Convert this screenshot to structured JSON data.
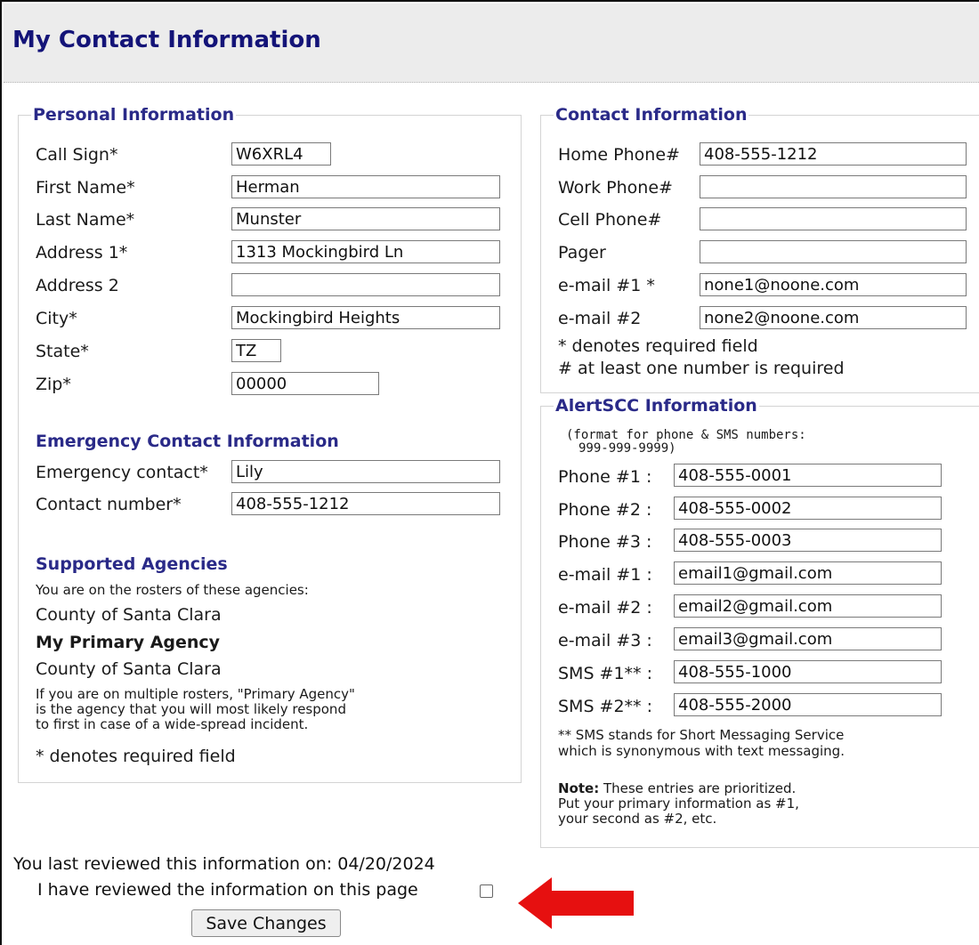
{
  "page": {
    "title": "My Contact Information"
  },
  "personal": {
    "legend": "Personal Information",
    "call_sign": {
      "label": "Call Sign*",
      "value": "W6XRL4"
    },
    "first_name": {
      "label": "First Name*",
      "value": "Herman"
    },
    "last_name": {
      "label": "Last Name*",
      "value": "Munster"
    },
    "address1": {
      "label": "Address 1*",
      "value": "1313 Mockingbird Ln"
    },
    "address2": {
      "label": "Address 2",
      "value": ""
    },
    "city": {
      "label": "City*",
      "value": "Mockingbird Heights"
    },
    "state": {
      "label": "State*",
      "value": "TZ"
    },
    "zip": {
      "label": "Zip*",
      "value": "00000"
    },
    "emergency": {
      "title": "Emergency Contact Information",
      "contact": {
        "label": "Emergency contact*",
        "value": "Lily"
      },
      "number": {
        "label": "Contact number*",
        "value": "408-555-1212"
      }
    },
    "agencies": {
      "title": "Supported Agencies",
      "note": "You are on the rosters of these agencies:",
      "roster": "County of Santa Clara",
      "primary_title": "My Primary Agency",
      "primary": "County of Santa Clara",
      "explain_1": "If you are on multiple rosters, \"Primary Agency\"",
      "explain_2": "is the agency that you will most likely respond",
      "explain_3": "to first in case of a wide-spread incident.",
      "required_note": "* denotes required field"
    }
  },
  "contact": {
    "legend": "Contact Information",
    "home_phone": {
      "label": "Home Phone#",
      "value": "408-555-1212"
    },
    "work_phone": {
      "label": "Work Phone#",
      "value": ""
    },
    "cell_phone": {
      "label": "Cell Phone#",
      "value": ""
    },
    "pager": {
      "label": "Pager",
      "value": ""
    },
    "email1": {
      "label": "e-mail #1 *",
      "value": "none1@noone.com"
    },
    "email2": {
      "label": "e-mail #2",
      "value": "none2@noone.com"
    },
    "note_required": "* denotes required field",
    "note_number": "# at least one number is required"
  },
  "alert": {
    "legend": "AlertSCC Information",
    "format_1": "(format for phone & SMS numbers:",
    "format_2": "999-999-9999)",
    "phone1": {
      "label": "Phone #1 :",
      "value": "408-555-0001"
    },
    "phone2": {
      "label": "Phone #2 :",
      "value": "408-555-0002"
    },
    "phone3": {
      "label": "Phone #3 :",
      "value": "408-555-0003"
    },
    "email1": {
      "label": "e-mail #1 :",
      "value": "email1@gmail.com"
    },
    "email2": {
      "label": "e-mail #2 :",
      "value": "email2@gmail.com"
    },
    "email3": {
      "label": "e-mail #3 :",
      "value": "email3@gmail.com"
    },
    "sms1": {
      "label": "SMS #1** :",
      "value": "408-555-1000"
    },
    "sms2": {
      "label": "SMS #2** :",
      "value": "408-555-2000"
    },
    "sms_note_1": "** SMS stands for Short Messaging Service",
    "sms_note_2": "which is synonymous with text messaging.",
    "note_bold": "Note:",
    "note_1": " These entries are prioritized.",
    "note_2": "Put your primary information as #1,",
    "note_3": "your second as #2, etc."
  },
  "footer": {
    "reviewed_label": "You last reviewed this information on:",
    "reviewed_date": "04/20/2024",
    "confirm_label": "I have reviewed the information on this page",
    "confirm_checked": false,
    "save_label": "Save Changes"
  },
  "annotation": {
    "arrow_color": "#e61010"
  }
}
